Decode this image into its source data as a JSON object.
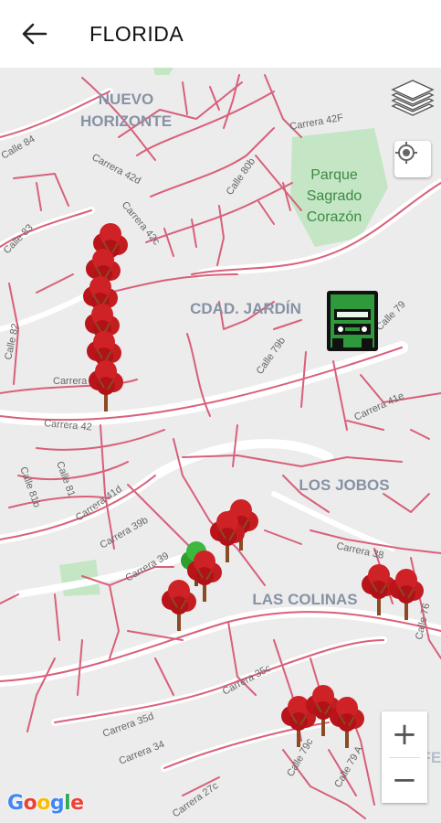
{
  "header": {
    "title": "FLORIDA",
    "back_icon": "arrow-left-icon"
  },
  "map": {
    "neighborhoods": [
      "NUEVO",
      "HORIZONTE",
      "CDAD. JARDÍN",
      "LOS JOBOS",
      "LAS COLINAS",
      "SAN FE"
    ],
    "park": [
      "Parque",
      "Sagrado",
      "Corazón"
    ],
    "streets": [
      "Calle 84",
      "Carrera 42d",
      "Carrera 42F",
      "Calle 80b",
      "Calle 83",
      "Carrera 42c",
      "Calle 82",
      "Calle 79",
      "Calle 79b",
      "Carrera",
      "Carrera 41e",
      "Carrera 42",
      "Calle 81b",
      "Calle 81",
      "Carrera 41d",
      "Carrera 39b",
      "Carrera 39",
      "Carrera 38",
      "Calle 76",
      "Carrera 35c",
      "Carrera 35d",
      "Carrera 34",
      "Calle 79c",
      "Calle 79 A",
      "Carrera 27c"
    ],
    "markers": {
      "truck_icon": "garbage-truck-icon",
      "tree_icon": "tree-icon"
    },
    "colors": {
      "map_bg": "#ececec",
      "road": "#ffffff",
      "route": "#d8607a",
      "park": "#c4e6c4",
      "tree_red": "#c0161b",
      "tree_green": "#2e9e2e",
      "truck": "#2e9a3b"
    }
  },
  "controls": {
    "layers_icon": "layers-icon",
    "locate_icon": "my-location-icon",
    "zoom_in": "+",
    "zoom_out": "−"
  },
  "attribution": {
    "logo": "Google"
  }
}
